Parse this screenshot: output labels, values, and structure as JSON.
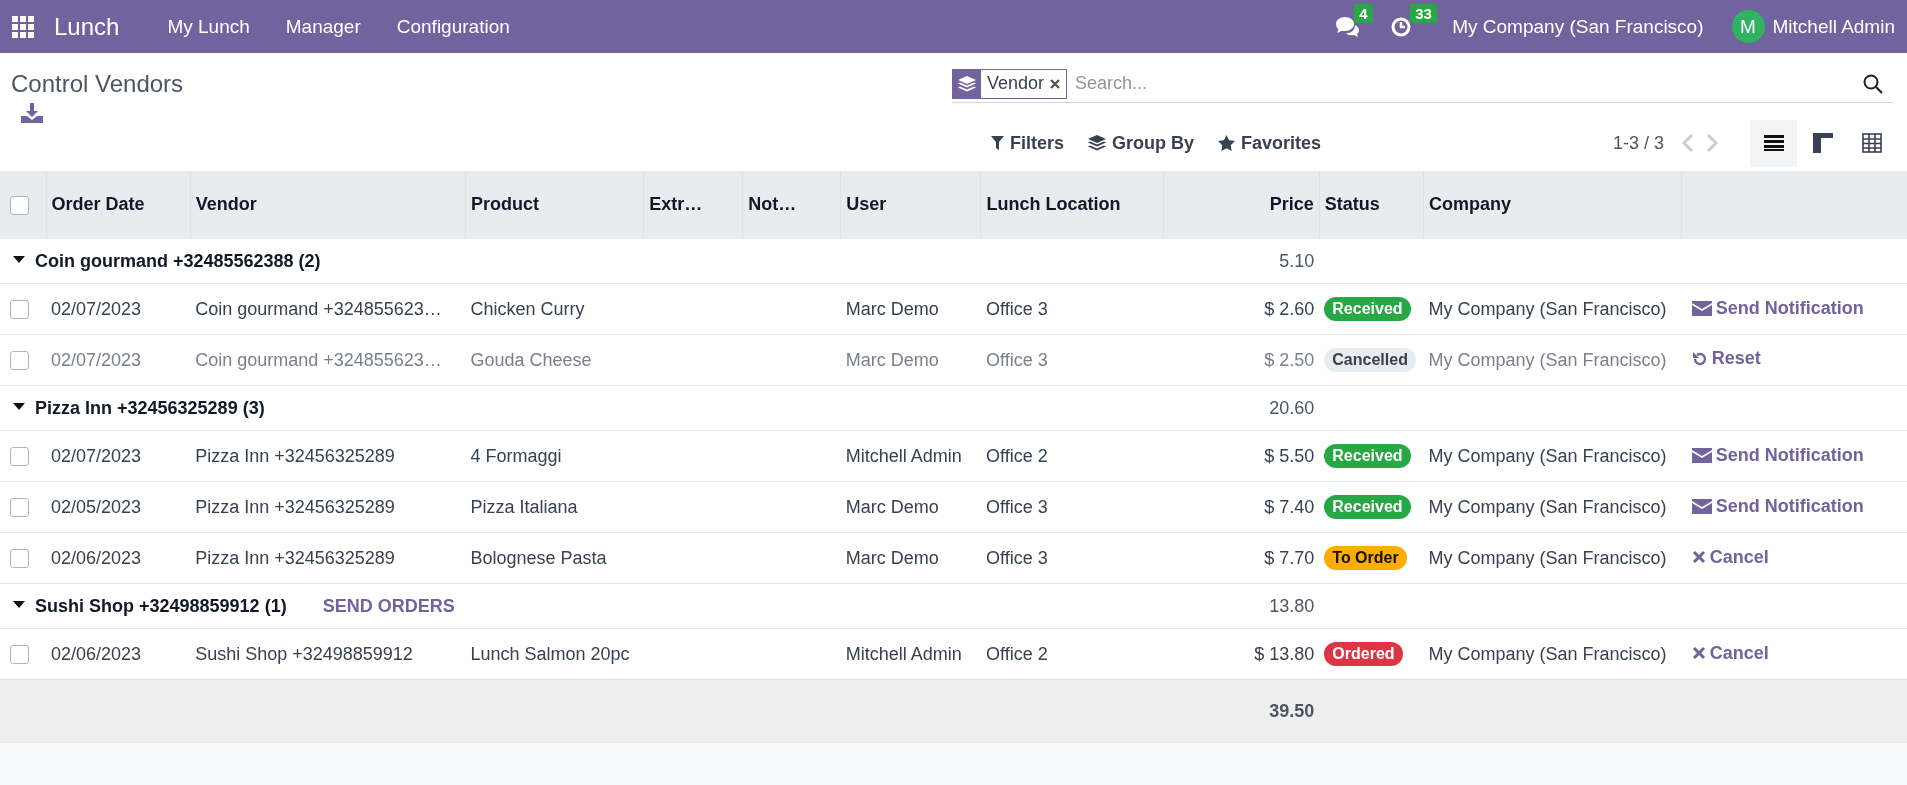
{
  "navbar": {
    "app": "Lunch",
    "menus": [
      "My Lunch",
      "Manager",
      "Configuration"
    ],
    "messages_count": "4",
    "activities_count": "33",
    "company": "My Company (San Francisco)",
    "user_initial": "M",
    "user": "Mitchell Admin"
  },
  "control_panel": {
    "title": "Control Vendors",
    "facet": "Vendor",
    "search": {
      "placeholder": "Search..."
    },
    "filters": [
      "Filters",
      "Group By",
      "Favorites"
    ],
    "pager": "1-3 / 3",
    "views": [
      {
        "kind": "list",
        "selected": true
      },
      {
        "kind": "kanban",
        "selected": false
      },
      {
        "kind": "pivot",
        "selected": false
      }
    ]
  },
  "table": {
    "select_all": {
      "checked": false
    },
    "columns": [
      "Order Date",
      "Vendor",
      "Product",
      "Extr…",
      "Not…",
      "User",
      "Lunch Location",
      "Price",
      "Status",
      "Company"
    ],
    "groups": [
      {
        "label": "Coin gourmand +32485562388 (2)",
        "expanded": true,
        "total": "5.10",
        "rows": [
          {
            "checked": false,
            "muted": false,
            "cells": [
              "02/07/2023",
              "Coin gourmand +324855623…",
              "Chicken Curry",
              "",
              "",
              "Marc Demo",
              "Office 3",
              "$ 2.60"
            ],
            "status": {
              "label": "Received",
              "color": "#28a745"
            },
            "company": "My Company (San Francisco)",
            "action": {
              "kind": "notify",
              "label": "Send Notification"
            }
          },
          {
            "checked": false,
            "muted": true,
            "cells": [
              "02/07/2023",
              "Coin gourmand +324855623…",
              "Gouda Cheese",
              "",
              "",
              "Marc Demo",
              "Office 3",
              "$ 2.50"
            ],
            "status": {
              "label": "Cancelled",
              "color": "#e9ecef"
            },
            "company": "My Company (San Francisco)",
            "action": {
              "kind": "reset",
              "label": "Reset"
            }
          }
        ]
      },
      {
        "label": "Pizza Inn +32456325289 (3)",
        "expanded": true,
        "total": "20.60",
        "rows": [
          {
            "checked": false,
            "muted": false,
            "cells": [
              "02/07/2023",
              "Pizza Inn +32456325289",
              "4 Formaggi",
              "",
              "",
              "Mitchell Admin",
              "Office 2",
              "$ 5.50"
            ],
            "status": {
              "label": "Received",
              "color": "#28a745"
            },
            "company": "My Company (San Francisco)",
            "action": {
              "kind": "notify",
              "label": "Send Notification"
            }
          },
          {
            "checked": false,
            "muted": false,
            "cells": [
              "02/05/2023",
              "Pizza Inn +32456325289",
              "Pizza Italiana",
              "",
              "",
              "Marc Demo",
              "Office 3",
              "$ 7.40"
            ],
            "status": {
              "label": "Received",
              "color": "#28a745"
            },
            "company": "My Company (San Francisco)",
            "action": {
              "kind": "notify",
              "label": "Send Notification"
            }
          },
          {
            "checked": false,
            "muted": false,
            "cells": [
              "02/06/2023",
              "Pizza Inn +32456325289",
              "Bolognese Pasta",
              "",
              "",
              "Marc Demo",
              "Office 3",
              "$ 7.70"
            ],
            "status": {
              "label": "To Order",
              "color": "#ffac00"
            },
            "company": "My Company (San Francisco)",
            "action": {
              "kind": "cancel",
              "label": "Cancel"
            }
          }
        ]
      },
      {
        "label": "Sushi Shop +32498859912 (1)",
        "expanded": true,
        "total": "13.80",
        "button": "SEND ORDERS",
        "rows": [
          {
            "checked": false,
            "muted": false,
            "cells": [
              "02/06/2023",
              "Sushi Shop +32498859912",
              "Lunch Salmon 20pc",
              "",
              "",
              "Mitchell Admin",
              "Office 2",
              "$ 13.80"
            ],
            "status": {
              "label": "Ordered",
              "color": "#dc3545"
            },
            "company": "My Company (San Francisco)",
            "action": {
              "kind": "cancel",
              "label": "Cancel"
            }
          }
        ]
      }
    ],
    "grand_total": "39.50"
  }
}
